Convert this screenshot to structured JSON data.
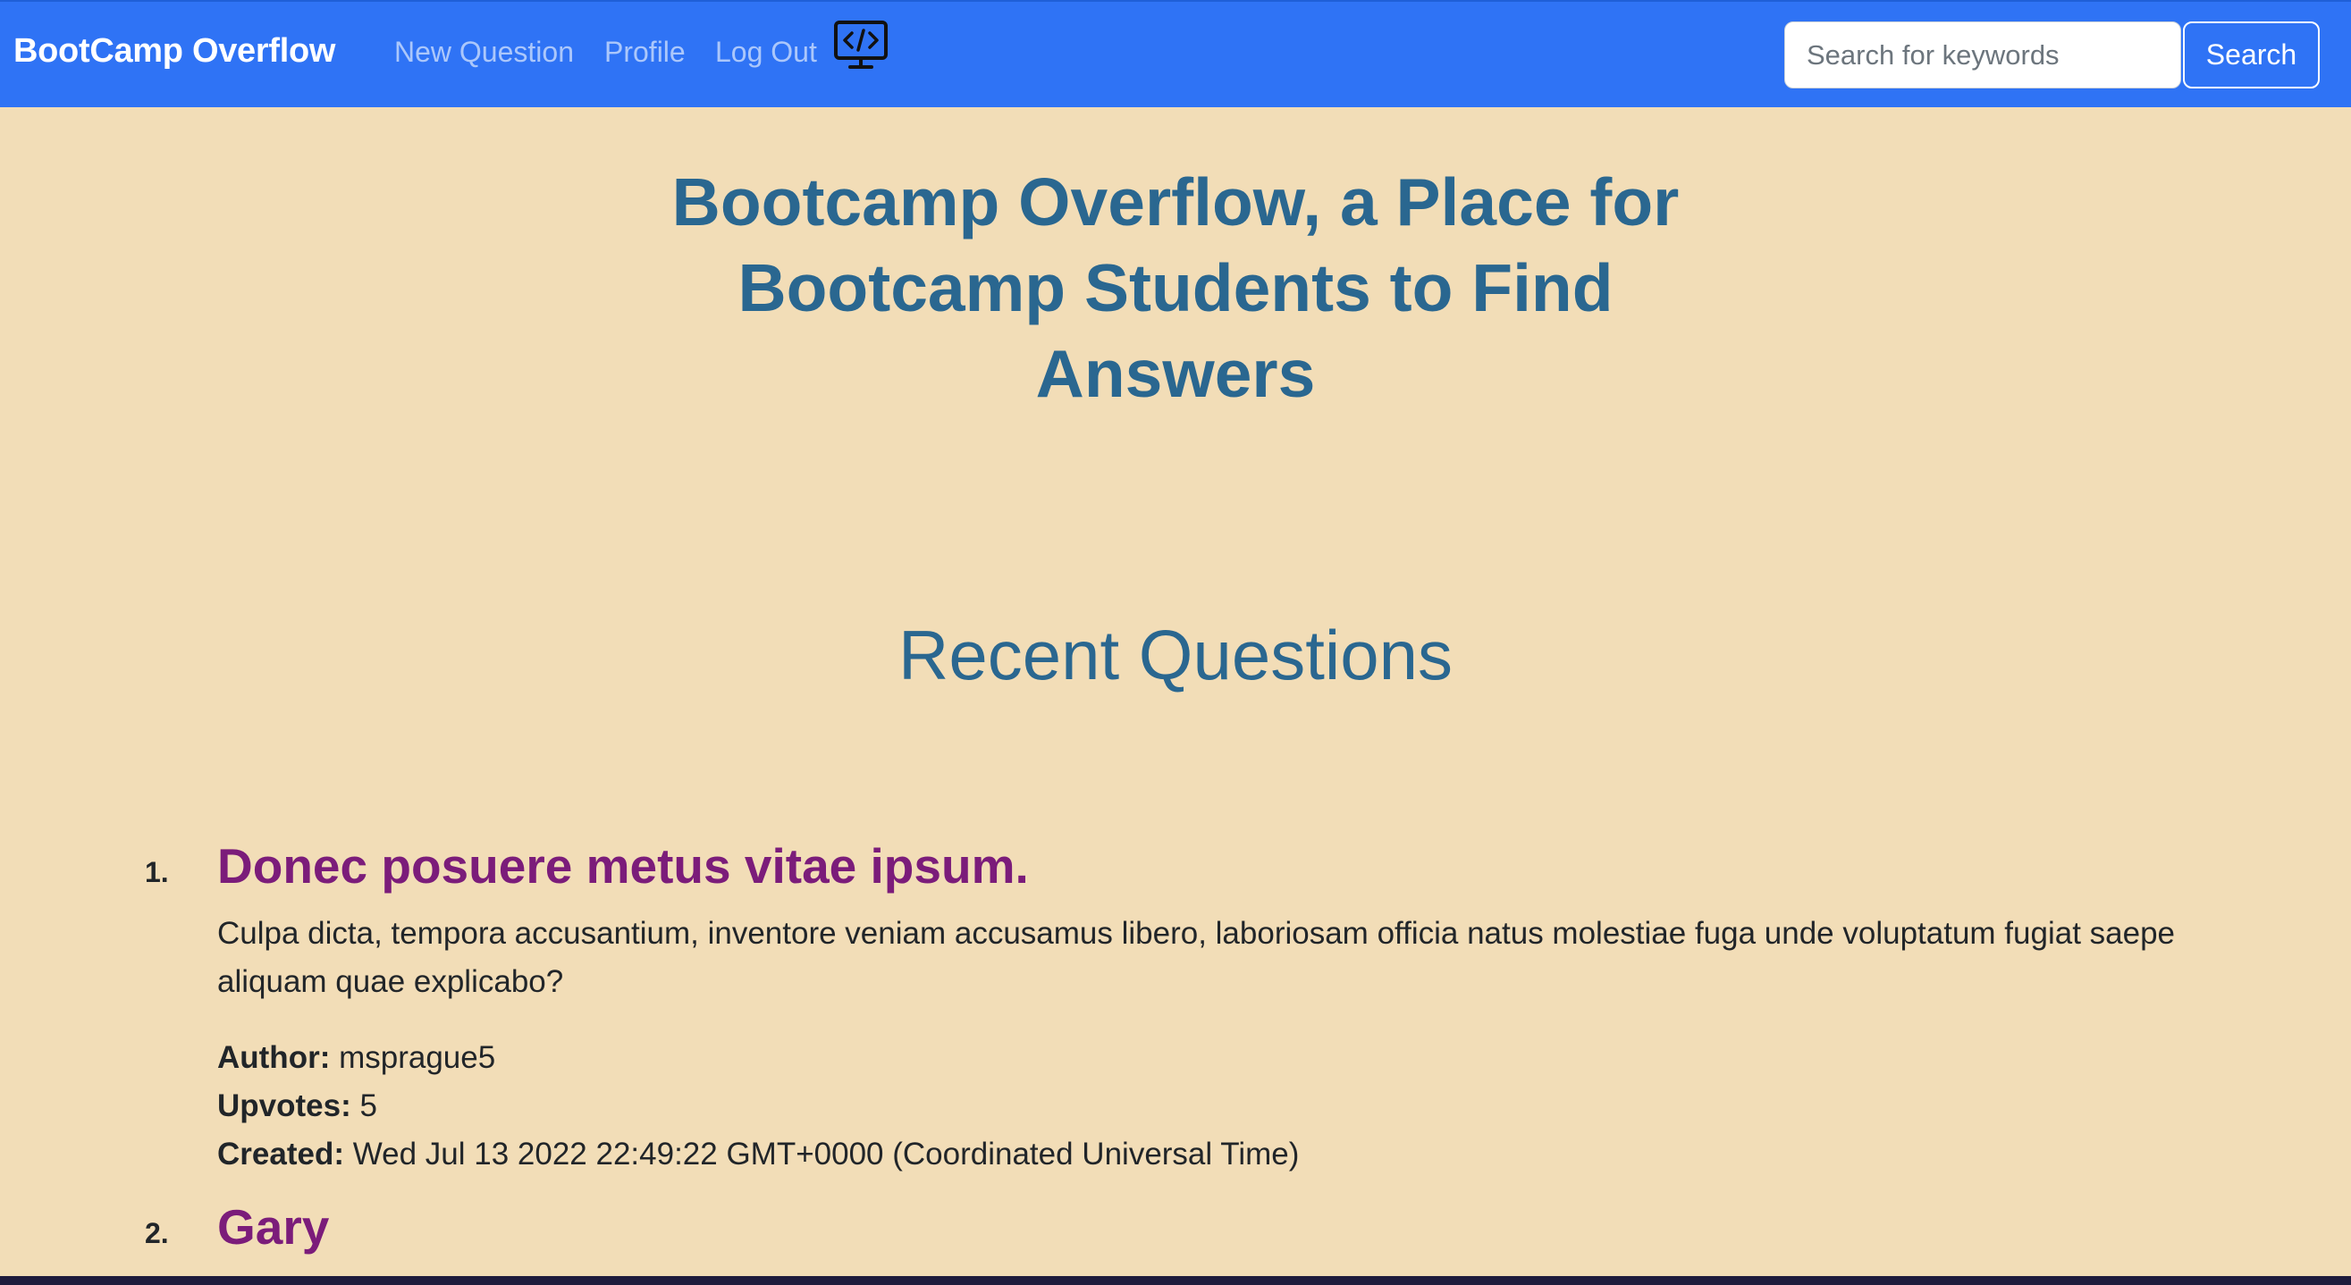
{
  "navbar": {
    "brand": "BootCamp Overflow",
    "links": {
      "new_question": "New Question",
      "profile": "Profile",
      "log_out": "Log Out"
    },
    "logo_icon": "monitor-code-icon",
    "search": {
      "placeholder": "Search for keywords",
      "value": "",
      "button_label": "Search"
    },
    "colors": {
      "background": "#2f73f5",
      "brand_text": "#ffffff"
    }
  },
  "hero": {
    "title": "Bootcamp Overflow, a Place for Bootcamp Students to Find Answers"
  },
  "recent": {
    "heading": "Recent Questions",
    "questions": [
      {
        "number": "1.",
        "title": "Donec posuere metus vitae ipsum.",
        "body": "Culpa dicta, tempora accusantium, inventore veniam accusamus libero, laboriosam officia natus molestiae fuga unde voluptatum fugiat saepe aliquam quae explicabo?",
        "author_label": "Author:",
        "author": "msprague5",
        "upvotes_label": "Upvotes:",
        "upvotes": "5",
        "created_label": "Created:",
        "created": "Wed Jul 13 2022 22:49:22 GMT+0000 (Coordinated Universal Time)"
      },
      {
        "number": "2.",
        "title": "Gary"
      }
    ]
  },
  "theme": {
    "page_background": "#f2ddb7",
    "heading_color": "#2a6790",
    "question_title_color": "#7b1c7a"
  }
}
